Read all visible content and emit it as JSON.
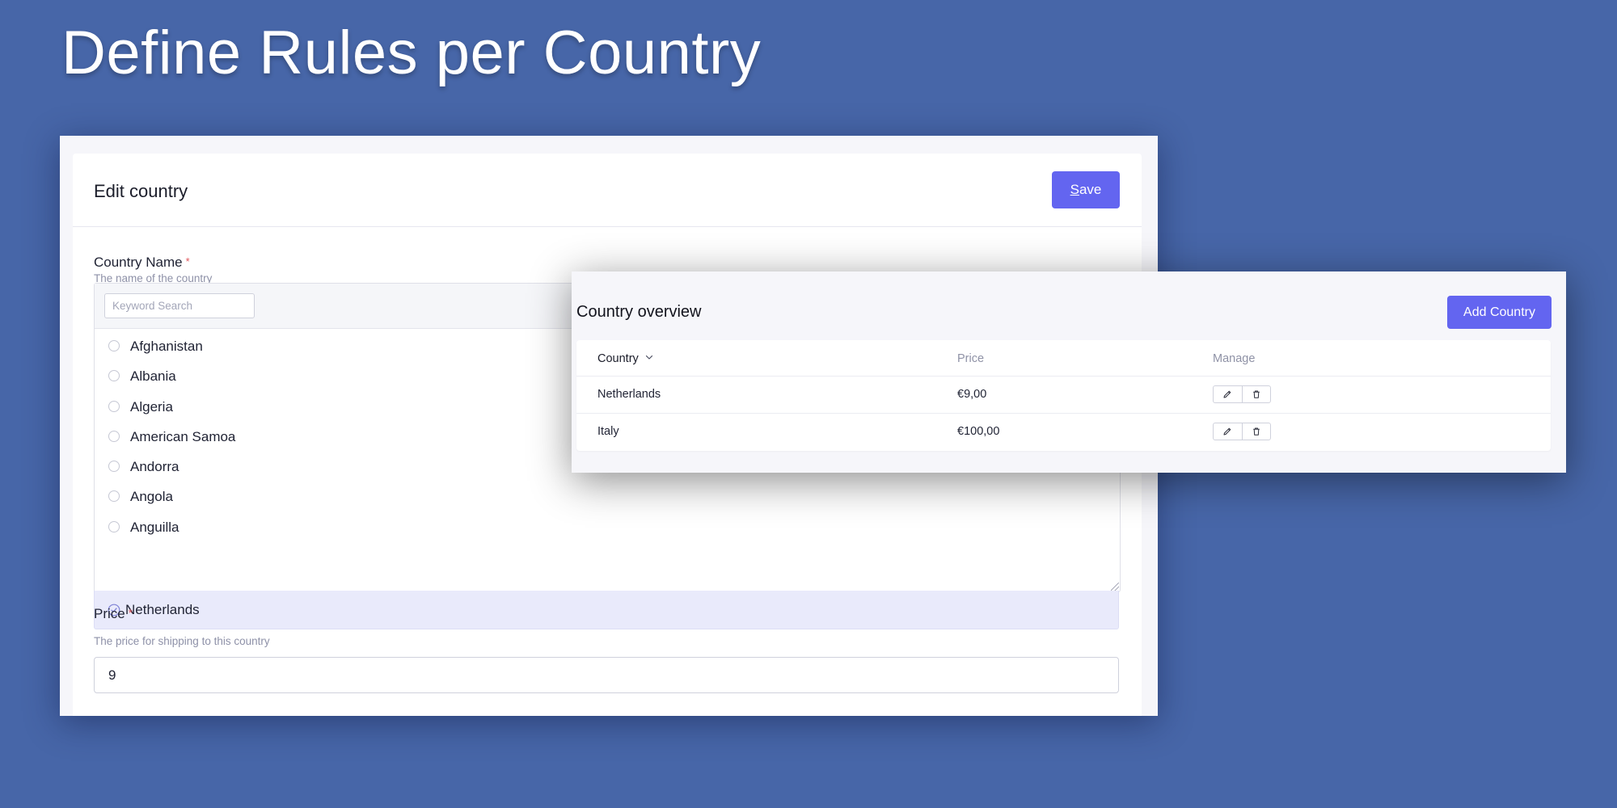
{
  "headline": "Define Rules per Country",
  "edit": {
    "title": "Edit country",
    "save_first_letter": "S",
    "save_rest": "ave",
    "country_field": {
      "label": "Country Name",
      "required_mark": "*",
      "help": "The name of the country",
      "search_placeholder": "Keyword Search",
      "options": [
        "Afghanistan",
        "Albania",
        "Algeria",
        "American Samoa",
        "Andorra",
        "Angola",
        "Anguilla"
      ],
      "selected": "Netherlands"
    },
    "price_field": {
      "label": "Price",
      "required_mark": "*",
      "help": "The price for shipping to this country",
      "value": "9"
    }
  },
  "overview": {
    "title": "Country overview",
    "add_label": "Add Country",
    "columns": {
      "country": "Country",
      "price": "Price",
      "manage": "Manage"
    },
    "rows": [
      {
        "country": "Netherlands",
        "price": "€9,00"
      },
      {
        "country": "Italy",
        "price": "€100,00"
      }
    ]
  },
  "icons": {
    "edit": "pencil-icon",
    "delete": "trash-icon",
    "selected": "check-circle-icon",
    "sort": "chevron-down-icon"
  },
  "colors": {
    "background": "#4766a8",
    "accent": "#6365f0",
    "selected_bg": "#e9eafb",
    "required": "#e0565b"
  }
}
